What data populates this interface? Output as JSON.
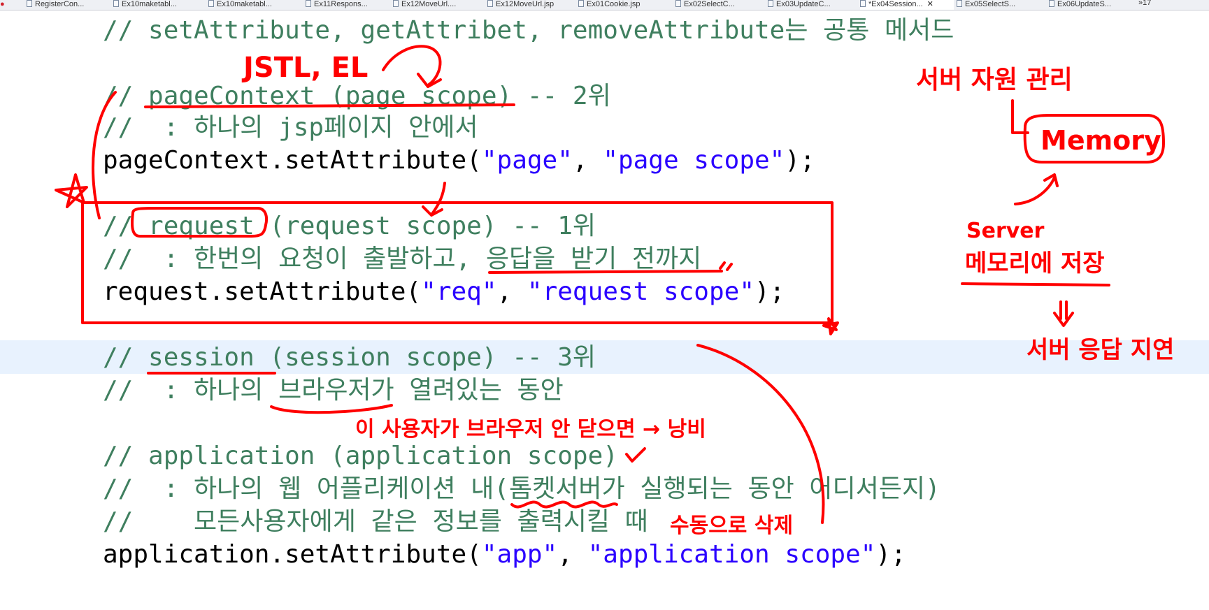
{
  "tabs": [
    {
      "label": "RegisterCon...",
      "active": false
    },
    {
      "label": "Ex10maketabl...",
      "active": false
    },
    {
      "label": "Ex10maketabl...",
      "active": false
    },
    {
      "label": "Ex11Respons...",
      "active": false
    },
    {
      "label": "Ex12MoveUrl....",
      "active": false
    },
    {
      "label": "Ex12MoveUrl.jsp",
      "active": false
    },
    {
      "label": "Ex01Cookie.jsp",
      "active": false
    },
    {
      "label": "Ex02SelectC...",
      "active": false
    },
    {
      "label": "Ex03UpdateC...",
      "active": false
    },
    {
      "label": "*Ex04Session...",
      "active": true
    },
    {
      "label": "Ex05SelectS...",
      "active": false
    },
    {
      "label": "Ex06UpdateS...",
      "active": false
    }
  ],
  "tabs_overflow": "»17",
  "code": {
    "line1": "// setAttribute, getAttribet, removeAttribute는 공통 메서드",
    "line2": "// pageContext (page scope) -- 2위",
    "line3": "//  : 하나의 jsp페이지 안에서",
    "line4_call": "pageContext.setAttribute(",
    "line4_s1": "\"page\"",
    "line4_sep": ", ",
    "line4_s2": "\"page scope\"",
    "line4_end": ");",
    "line5": "// request (request scope) -- 1위",
    "line6": "//  : 한번의 요청이 출발하고, 응답을 받기 전까지",
    "line7_call": "request.setAttribute(",
    "line7_s1": "\"req\"",
    "line7_sep": ", ",
    "line7_s2": "\"request scope\"",
    "line7_end": ");",
    "line8": "// session (session scope) -- 3위",
    "line9": "//  : 하나의 브라우저가 열려있는 동안",
    "line10": "// application (application scope)",
    "line11": "//  : 하나의 웹 어플리케이션 내(톰켓서버가 실행되는 동안 어디서든지)",
    "line12": "//    모든사용자에게 같은 정보를 출력시킬 때",
    "line13_call": "application.setAttribute(",
    "line13_s1": "\"app\"",
    "line13_sep": ", ",
    "line13_s2": "\"application scope\"",
    "line13_end": ");"
  },
  "annotations": {
    "jstl_el": "JSTL, EL",
    "server_resource": "서버 자원 관리",
    "memory": "Memory",
    "server": "Server",
    "memory_store": "메모리에 저장",
    "server_delay": "서버 응답 지연",
    "waste_note": "이 사용자가 브라우저 안 닫으면 → 낭비",
    "manual_delete": "수동으로 삭제",
    "star": "★"
  },
  "colors": {
    "comment": "#3f7f5f",
    "string": "#2a00ff",
    "code": "#000000",
    "annotation": "#ff0000",
    "current_line": "#e8f2fe"
  }
}
